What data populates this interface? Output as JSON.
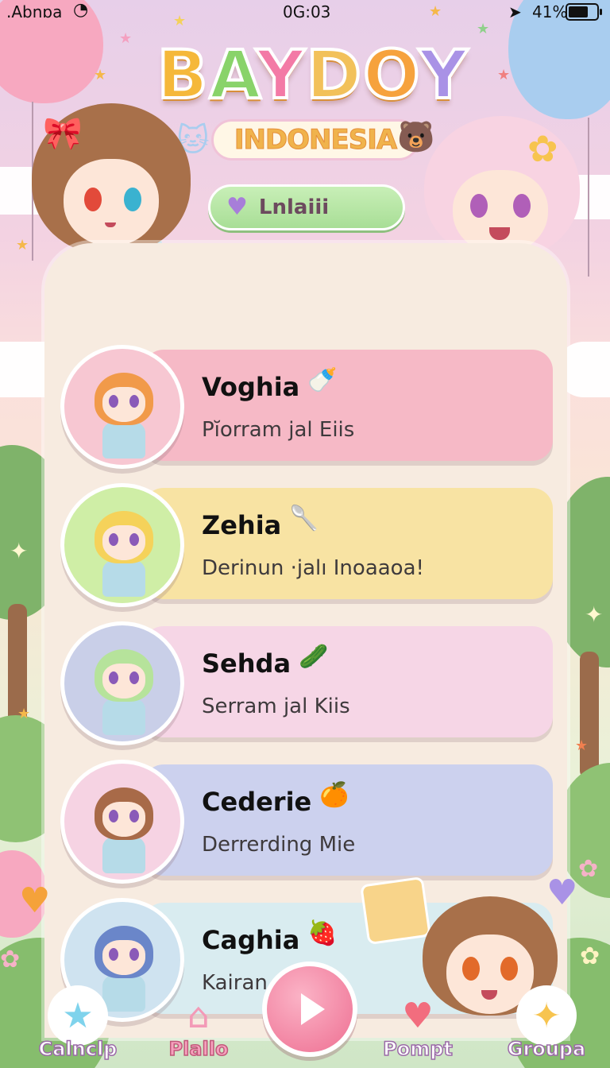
{
  "status_bar": {
    "carrier": ".Abnɒa",
    "time": "0G:03",
    "battery": "41%"
  },
  "logo": {
    "title_letters": [
      "B",
      "A",
      "Y",
      "D",
      "O",
      "Y"
    ],
    "subtitle": "INDONESIA"
  },
  "pill_button": {
    "label": "Lnlaiii",
    "icon": "heart-icon"
  },
  "list": [
    {
      "name": "Voghia",
      "subtitle": "Pĭorram jal Eiis",
      "card_color": "#f6b9c6",
      "avatar_bg": "#f7c7d2",
      "hair": "#f19a4a",
      "icon": "🍼"
    },
    {
      "name": "Zehia",
      "subtitle": "Derinun ·jalı Inoaaoa!",
      "card_color": "#f8e3a3",
      "avatar_bg": "#cfeea6",
      "hair": "#f5d25a",
      "icon": "🥄"
    },
    {
      "name": "Sehda",
      "subtitle": "Serram jal Kiis",
      "card_color": "#f6d6e6",
      "avatar_bg": "#c9cfe8",
      "hair": "#b6e39b",
      "icon": "🥒"
    },
    {
      "name": "Cederie",
      "subtitle": "Derrerding Mie",
      "card_color": "#ccd1ee",
      "avatar_bg": "#f6d3e3",
      "hair": "#a86a48",
      "icon": "🍊"
    },
    {
      "name": "Caghia",
      "subtitle": "Kairan",
      "card_color": "#d9ecf0",
      "avatar_bg": "#cfe3f0",
      "hair": "#6a86c9",
      "icon": "🍓"
    }
  ],
  "nav": [
    {
      "label": "Calnclp",
      "icon": "star-icon",
      "glyph": "★",
      "color": "#7fd3ec"
    },
    {
      "label": "Plallo",
      "icon": "house-icon",
      "glyph": "⌂",
      "color": "#f39ab7"
    },
    {
      "label": "Pompt",
      "icon": "heart-icon",
      "glyph": "♥",
      "color": "#f26d7e"
    },
    {
      "label": "Groupa",
      "icon": "puzzle-icon",
      "glyph": "✦",
      "color": "#f7c44f"
    }
  ],
  "colors": {
    "panel": "#f7ebe0",
    "accent_pink": "#ee6f92",
    "pill_green": "#b5e6a3"
  }
}
